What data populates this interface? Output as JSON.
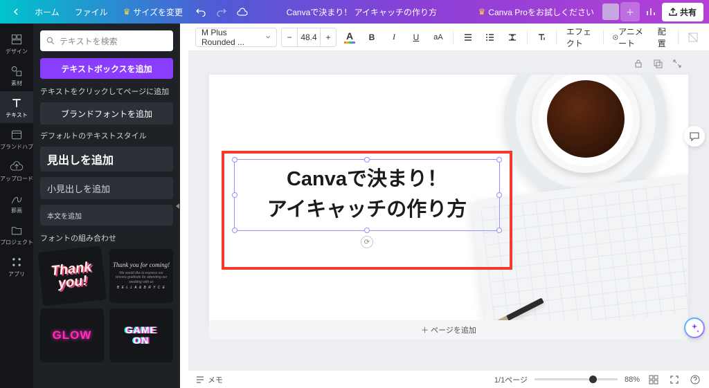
{
  "topbar": {
    "home": "ホーム",
    "file": "ファイル",
    "resize": "サイズを変更",
    "title": "Canvaで決まり！ アイキャッチの作り方",
    "try_pro": "Canva Proをお試しください",
    "share": "共有"
  },
  "sidenav": {
    "items": [
      {
        "label": "デザイン"
      },
      {
        "label": "素材"
      },
      {
        "label": "テキスト"
      },
      {
        "label": "ブランドハブ"
      },
      {
        "label": "アップロード"
      },
      {
        "label": "罫画"
      },
      {
        "label": "プロジェクト"
      },
      {
        "label": "アプリ"
      }
    ]
  },
  "panel": {
    "search_placeholder": "テキストを検索",
    "add_textbox": "テキストボックスを追加",
    "click_hint": "テキストをクリックしてページに追加",
    "brand_font": "ブランドフォントを追加",
    "default_styles": "デフォルトのテキストスタイル",
    "add_heading": "見出しを追加",
    "add_subheading": "小見出しを追加",
    "add_body": "本文を追加",
    "font_combos": "フォントの組み合わせ",
    "combo1a": "Thank",
    "combo1b": "you!",
    "combo2a": "Thank you for coming!",
    "combo2b": "We would like to express our sincere gratitude for attending our wedding with us",
    "combo2c": "B E L L A  &  B R Y C E",
    "combo3": "GLOW",
    "combo4a": "GAME",
    "combo4b": "ON"
  },
  "ctx": {
    "font_name": "M Plus Rounded ...",
    "font_size": "48.4",
    "effect": "エフェクト",
    "animate": "アニメート",
    "position": "配置"
  },
  "canvas": {
    "line1": "Canvaで決まり！",
    "line2": "アイキャッチの作り方"
  },
  "page": {
    "add_page": "＋ ページを追加",
    "notes": "メモ",
    "page_count": "1/1ページ",
    "zoom": "88%"
  }
}
